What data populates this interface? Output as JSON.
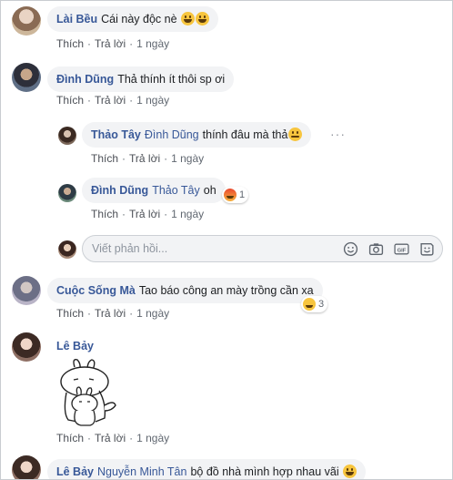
{
  "actions": {
    "like": "Thích",
    "reply": "Trả lời",
    "time": "1 ngày",
    "separator": "·"
  },
  "comments": [
    {
      "name": "Lài Bều",
      "text": "Cái này độc nè"
    },
    {
      "name": "Đình Dũng",
      "text": "Thả thính ít thôi sp ơi"
    },
    {
      "name": "Thảo Tây",
      "mention": "Đình Dũng",
      "text": "thính đâu mà thả"
    },
    {
      "name": "Đình Dũng",
      "mention": "Thảo Tây",
      "text": "oh",
      "reaction_count": "1"
    },
    {
      "name": "Cuộc Sống Mà",
      "text": "Tao báo công an mày trồng cần xa",
      "reaction_count": "3"
    },
    {
      "name": "Lê Bảy"
    },
    {
      "name": "Lê Bảy",
      "mention": "Nguyễn Minh Tân",
      "text": "bộ đồ nhà mình hợp nhau vãi"
    }
  ],
  "reply_box": {
    "placeholder": "Viết phản hồi..."
  },
  "colors": {
    "name": "#385898",
    "bubble": "#f2f3f5",
    "meta": "#606770"
  }
}
